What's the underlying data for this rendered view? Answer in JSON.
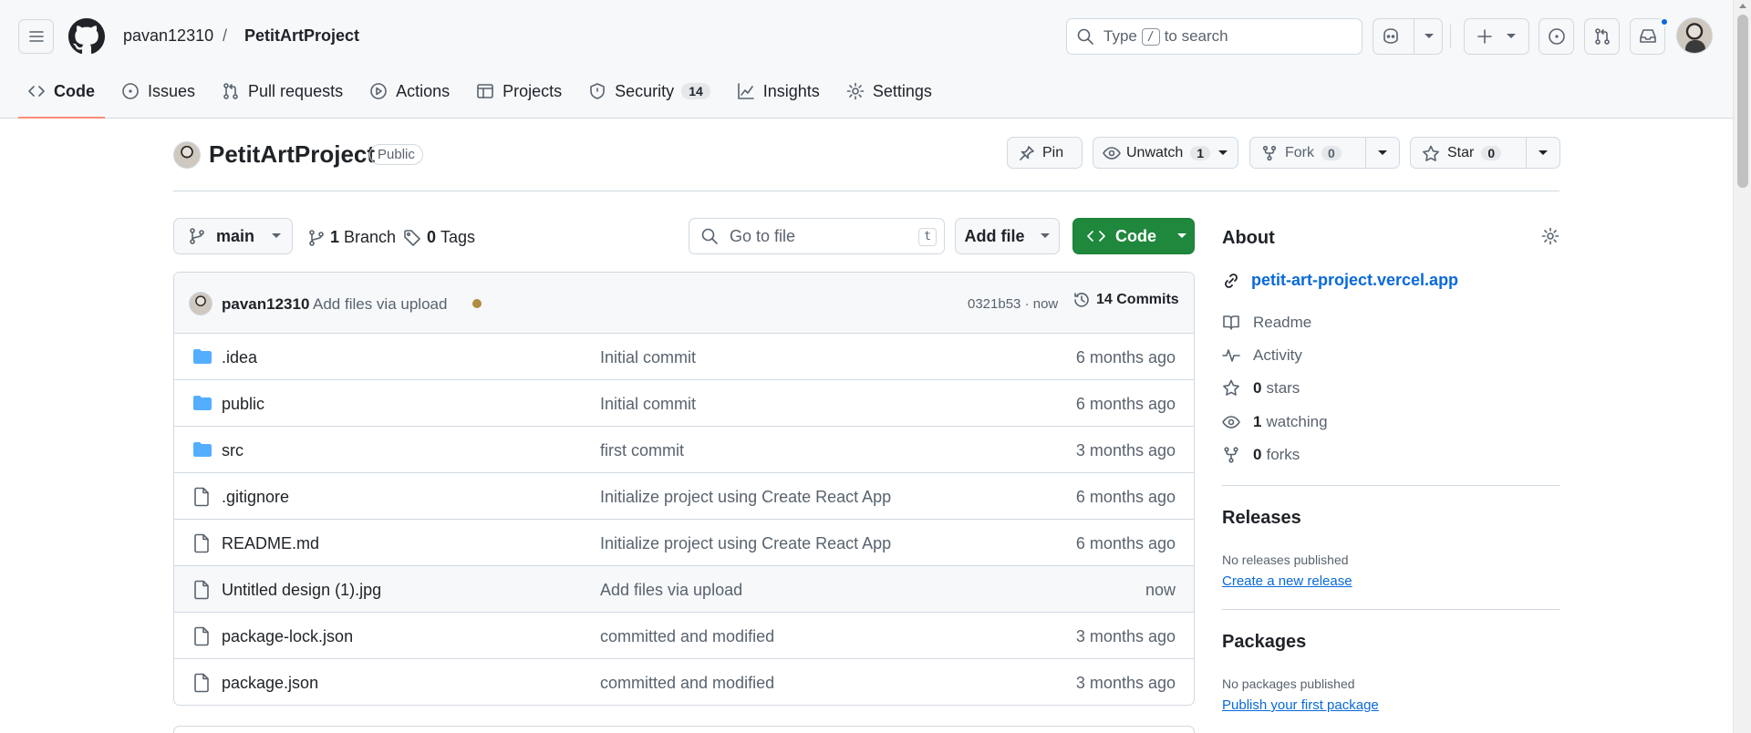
{
  "header": {
    "owner": "pavan12310",
    "separator": "/",
    "repo": "PetitArtProject",
    "search_prefix": "Type",
    "search_key": "/",
    "search_suffix": "to search"
  },
  "tabs": [
    {
      "label": "Code",
      "icon": "code-icon",
      "active": true
    },
    {
      "label": "Issues",
      "icon": "issue-icon"
    },
    {
      "label": "Pull requests",
      "icon": "pull-request-icon"
    },
    {
      "label": "Actions",
      "icon": "play-icon"
    },
    {
      "label": "Projects",
      "icon": "table-icon"
    },
    {
      "label": "Security",
      "icon": "shield-icon",
      "count": "14"
    },
    {
      "label": "Insights",
      "icon": "graph-icon"
    },
    {
      "label": "Settings",
      "icon": "gear-icon"
    }
  ],
  "repo": {
    "title": "PetitArtProject",
    "visibility": "Public",
    "pin_label": "Pin",
    "watch_label": "Unwatch",
    "watch_count": "1",
    "fork_label": "Fork",
    "fork_count": "0",
    "star_label": "Star",
    "star_count": "0"
  },
  "toolbar": {
    "branch": "main",
    "branch_count": "1",
    "branch_label": "Branch",
    "tag_count": "0",
    "tag_label": "Tags",
    "goto_placeholder": "Go to file",
    "goto_key": "t",
    "add_file": "Add file",
    "code": "Code"
  },
  "commit": {
    "author": "pavan12310",
    "message": "Add files via upload",
    "sha": "0321b53 · now",
    "commits": "14 Commits"
  },
  "files": [
    {
      "name": ".idea",
      "type": "folder",
      "message": "Initial commit",
      "time": "6 months ago"
    },
    {
      "name": "public",
      "type": "folder",
      "message": "Initial commit",
      "time": "6 months ago"
    },
    {
      "name": "src",
      "type": "folder",
      "message": "first commit",
      "time": "3 months ago"
    },
    {
      "name": ".gitignore",
      "type": "file",
      "message": "Initialize project using Create React App",
      "time": "6 months ago"
    },
    {
      "name": "README.md",
      "type": "file",
      "message": "Initialize project using Create React App",
      "time": "6 months ago"
    },
    {
      "name": "Untitled design (1).jpg",
      "type": "file",
      "message": "Add files via upload",
      "time": "now",
      "highlight": true
    },
    {
      "name": "package-lock.json",
      "type": "file",
      "message": "committed and modified",
      "time": "3 months ago"
    },
    {
      "name": "package.json",
      "type": "file",
      "message": "committed and modified",
      "time": "3 months ago"
    }
  ],
  "about": {
    "title": "About",
    "homepage": "petit-art-project.vercel.app",
    "readme": "Readme",
    "activity": "Activity",
    "stars_count": "0",
    "stars_label": "stars",
    "watching_count": "1",
    "watching_label": "watching",
    "forks_count": "0",
    "forks_label": "forks"
  },
  "releases": {
    "title": "Releases",
    "empty": "No releases published",
    "link": "Create a new release"
  },
  "packages": {
    "title": "Packages",
    "empty": "No packages published",
    "link": "Publish your first package"
  },
  "colors": {
    "accent": "#0969da",
    "primary_button": "#1f883d",
    "active_tab_underline": "#fd8c73",
    "folder": "#54aeff"
  }
}
